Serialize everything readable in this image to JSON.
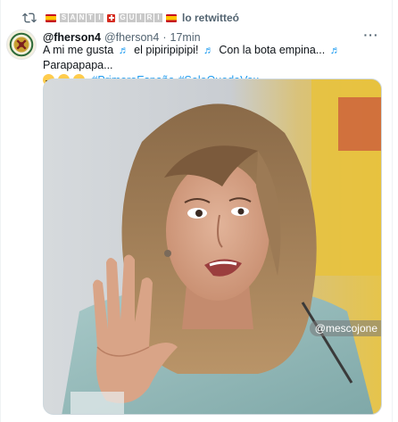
{
  "retweet": {
    "boxed_1": [
      "S",
      "A",
      "N",
      "T",
      "I"
    ],
    "boxed_2": [
      "G",
      "U",
      "I",
      "R",
      "I"
    ],
    "label": "lo retwitteó"
  },
  "tweet": {
    "display_name": "@fherson4",
    "handle": "@fherson4",
    "separator": "·",
    "time": "17min",
    "text_parts": {
      "p1": "A mi me gusta",
      "p2": "el pipiripipipi!",
      "p3": "Con la bota empina...",
      "p4": "Parapapapa..."
    },
    "hashtags": [
      "#PrimeroEspaña",
      "#SoloQuedaVox"
    ]
  },
  "media": {
    "watermark": "@mescojone"
  },
  "icons": {
    "retweet": "retweet-icon",
    "more": "more-icon",
    "music": "musical-notes-icon",
    "emoji": "laughing-emoji-icon"
  },
  "colors": {
    "accent": "#1d9bf0",
    "secondary_text": "#536471"
  }
}
